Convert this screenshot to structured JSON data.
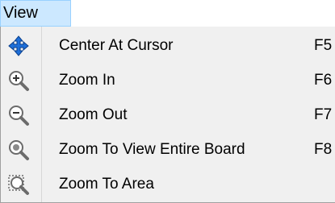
{
  "menubar": {
    "view_label": "View"
  },
  "menu": {
    "items": [
      {
        "label": "Center At Cursor",
        "shortcut": "F5",
        "icon": "move-arrows-icon"
      },
      {
        "label": "Zoom In",
        "shortcut": "F6",
        "icon": "zoom-in-icon"
      },
      {
        "label": "Zoom Out",
        "shortcut": "F7",
        "icon": "zoom-out-icon"
      },
      {
        "label": "Zoom To View Entire Board",
        "shortcut": "F8",
        "icon": "zoom-fit-icon"
      },
      {
        "label": "Zoom To Area",
        "shortcut": "",
        "icon": "zoom-area-icon"
      }
    ]
  },
  "colors": {
    "highlight": "#cce8ff",
    "menu_bg": "#f0f0f0",
    "icon_blue": "#1e6fd9"
  }
}
